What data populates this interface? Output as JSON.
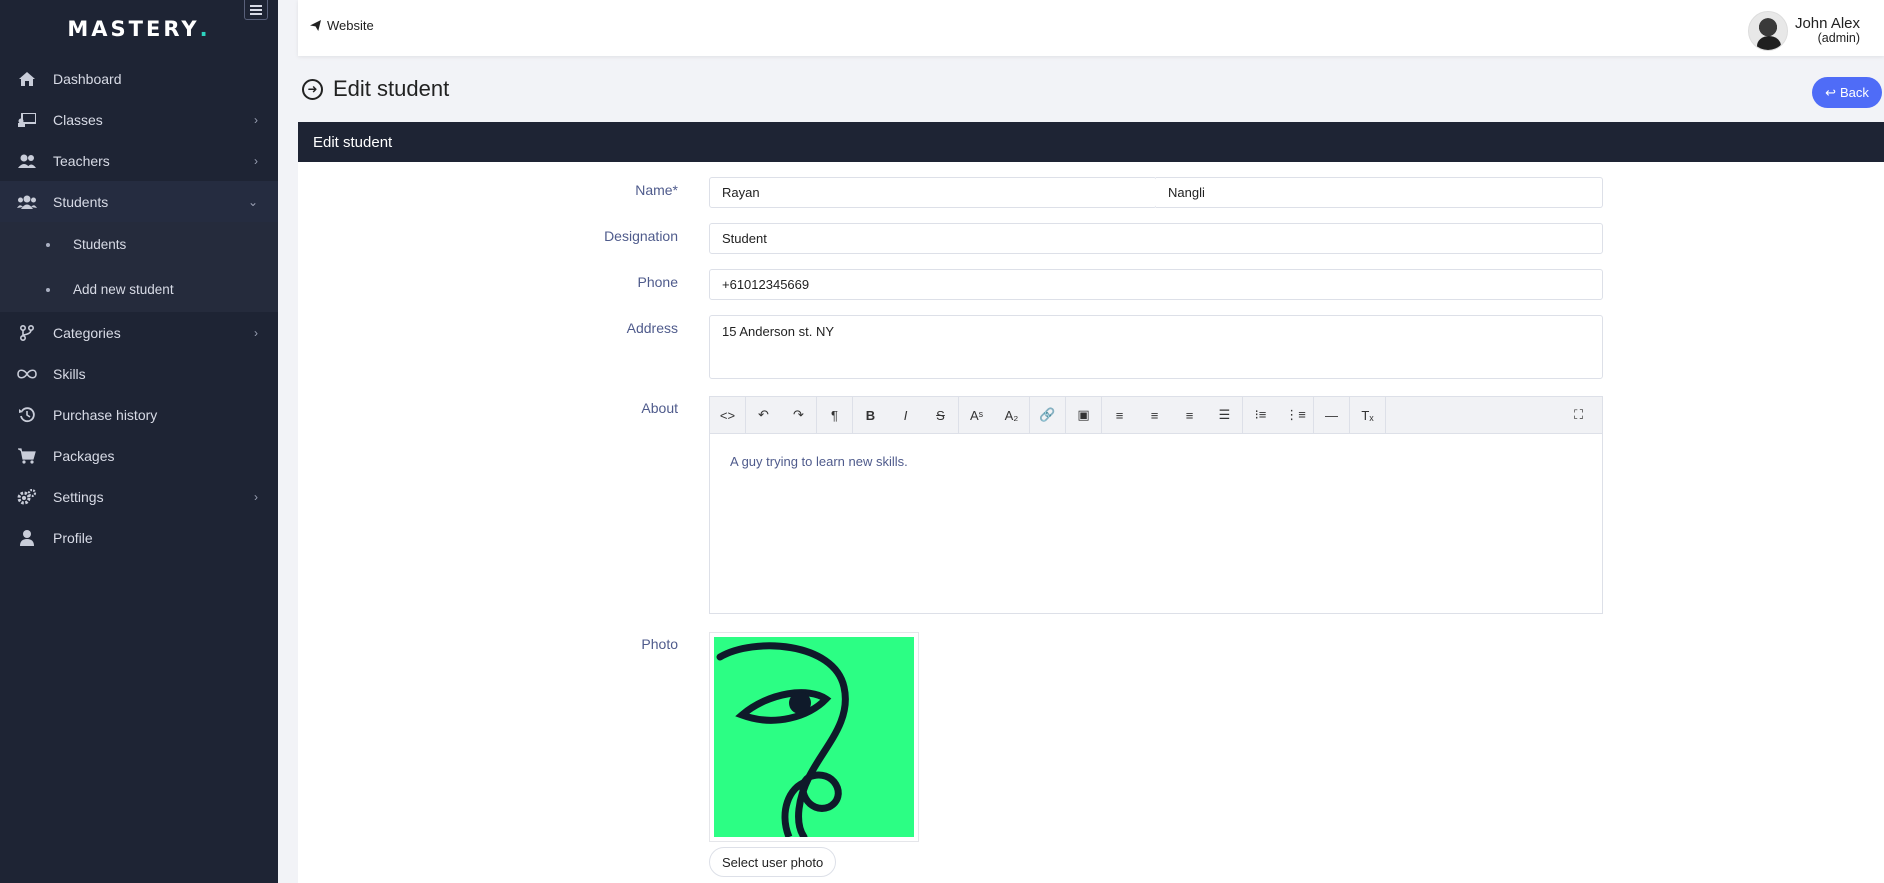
{
  "brand": {
    "name": "MASTERY",
    "dot": "."
  },
  "sidebar": {
    "items": [
      {
        "label": "Dashboard",
        "icon": "home-icon"
      },
      {
        "label": "Classes",
        "icon": "chalkboard-icon",
        "chevron": "›"
      },
      {
        "label": "Teachers",
        "icon": "user-group-icon",
        "chevron": "›"
      },
      {
        "label": "Students",
        "icon": "users-icon",
        "chevron": "⌄"
      },
      {
        "label": "Categories",
        "icon": "branch-icon",
        "chevron": "›"
      },
      {
        "label": "Skills",
        "icon": "infinity-icon"
      },
      {
        "label": "Purchase history",
        "icon": "history-icon"
      },
      {
        "label": "Packages",
        "icon": "cart-icon"
      },
      {
        "label": "Settings",
        "icon": "gears-icon",
        "chevron": "›"
      },
      {
        "label": "Profile",
        "icon": "user-icon"
      }
    ],
    "students_sub": [
      "Students",
      "Add new student"
    ]
  },
  "topbar": {
    "website_label": "Website",
    "user_name": "John Alex",
    "user_role": "(admin)"
  },
  "page": {
    "title": "Edit student",
    "back_label": "Back"
  },
  "form": {
    "header": "Edit student",
    "name_label": "Name*",
    "first_name": "Rayan",
    "last_name": "Nangli",
    "designation_label": "Designation",
    "designation": "Student",
    "phone_label": "Phone",
    "phone": "+61012345669",
    "address_label": "Address",
    "address": "15 Anderson st. NY",
    "about_label": "About",
    "about": "A guy trying to learn new skills.",
    "photo_label": "Photo",
    "select_photo_label": "Select user photo"
  },
  "colors": {
    "sidebar_bg": "#1e2434",
    "accent": "#4f6cf7",
    "label": "#4f5b8c",
    "photo_bg": "#2cfe84"
  }
}
